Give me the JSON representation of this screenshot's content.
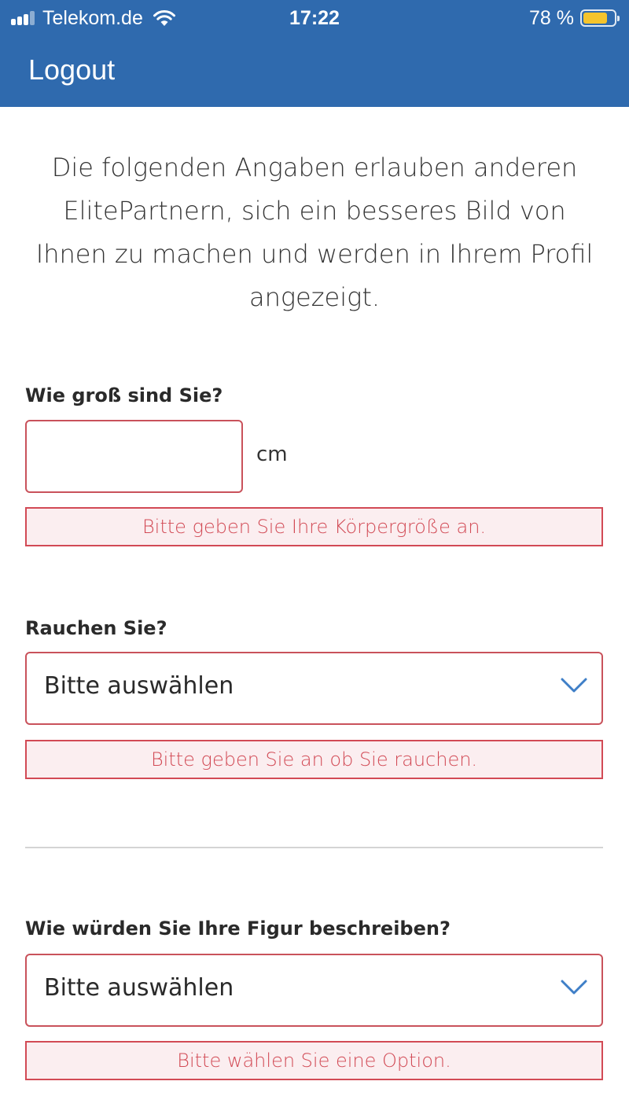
{
  "status_bar": {
    "carrier": "Telekom.de",
    "time": "17:22",
    "battery_percent": "78 %",
    "battery_level": 0.78,
    "icons": [
      "signal-icon",
      "wifi-icon",
      "battery-icon"
    ]
  },
  "nav": {
    "logout_label": "Logout"
  },
  "intro": {
    "text": "Die folgenden Angaben erlauben anderen ElitePartnern, sich ein besseres Bild von Ihnen zu machen und werden in Ihrem Profil angezeigt."
  },
  "height": {
    "label": "Wie groß sind Sie?",
    "value": "",
    "unit": "cm",
    "error": "Bitte geben Sie Ihre Körpergröße an."
  },
  "smoking": {
    "label": "Rauchen Sie?",
    "selected": "Bitte auswählen",
    "error": "Bitte geben Sie an ob Sie rauchen."
  },
  "figure": {
    "label": "Wie würden Sie Ihre Figur beschreiben?",
    "selected": "Bitte auswählen",
    "error": "Bitte wählen Sie eine Option."
  },
  "colors": {
    "header_bg": "#2f6aae",
    "error": "#d24a55",
    "error_bg": "#fbeef0",
    "chevron": "#3f7fc7",
    "battery": "#f5c42c"
  }
}
